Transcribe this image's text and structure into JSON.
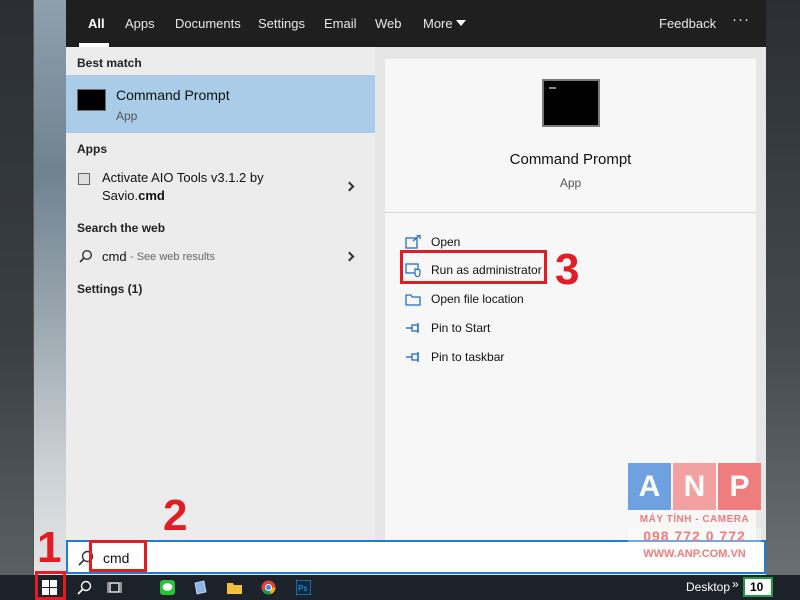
{
  "nav": {
    "tabs": [
      {
        "label": "All",
        "active": true
      },
      {
        "label": "Apps"
      },
      {
        "label": "Documents"
      },
      {
        "label": "Settings"
      },
      {
        "label": "Email"
      },
      {
        "label": "Web"
      },
      {
        "label": "More"
      }
    ],
    "feedback": "Feedback",
    "options": "···"
  },
  "results": {
    "best_match_heading": "Best match",
    "best_match": {
      "title": "Command Prompt",
      "subtitle": "App",
      "icon": "cmd-icon"
    },
    "apps_heading": "Apps",
    "app_item": {
      "line1": "Activate AIO Tools v3.1.2 by",
      "line2_prefix": "Savio.",
      "line2_bold": "cmd"
    },
    "web_heading": "Search the web",
    "web_item": {
      "query": "cmd",
      "suffix": "- See web results"
    },
    "settings_heading": "Settings (1)"
  },
  "detail": {
    "title": "Command Prompt",
    "subtitle": "App",
    "actions": [
      {
        "label": "Open",
        "icon": "open-icon"
      },
      {
        "label": "Run as administrator",
        "icon": "shield-icon"
      },
      {
        "label": "Open file location",
        "icon": "folder-icon"
      },
      {
        "label": "Pin to Start",
        "icon": "pin-icon"
      },
      {
        "label": "Pin to taskbar",
        "icon": "pin-icon"
      }
    ]
  },
  "search": {
    "value": "cmd"
  },
  "annotations": {
    "step1": "1",
    "step2": "2",
    "step3": "3",
    "color": "#e11c24"
  },
  "watermark": {
    "letters": [
      "A",
      "N",
      "P"
    ],
    "tagline": "MÁY TÍNH - CAMERA",
    "phone": "098 772 0 772",
    "website": "WWW.ANP.COM.VN"
  },
  "taskbar": {
    "desktop_label": "Desktop",
    "chevrons": "»",
    "badge": "10"
  },
  "colors": {
    "accent": "#1f7bd6",
    "selection": "#a9cde8",
    "nav_bg": "#1f1f1f"
  }
}
